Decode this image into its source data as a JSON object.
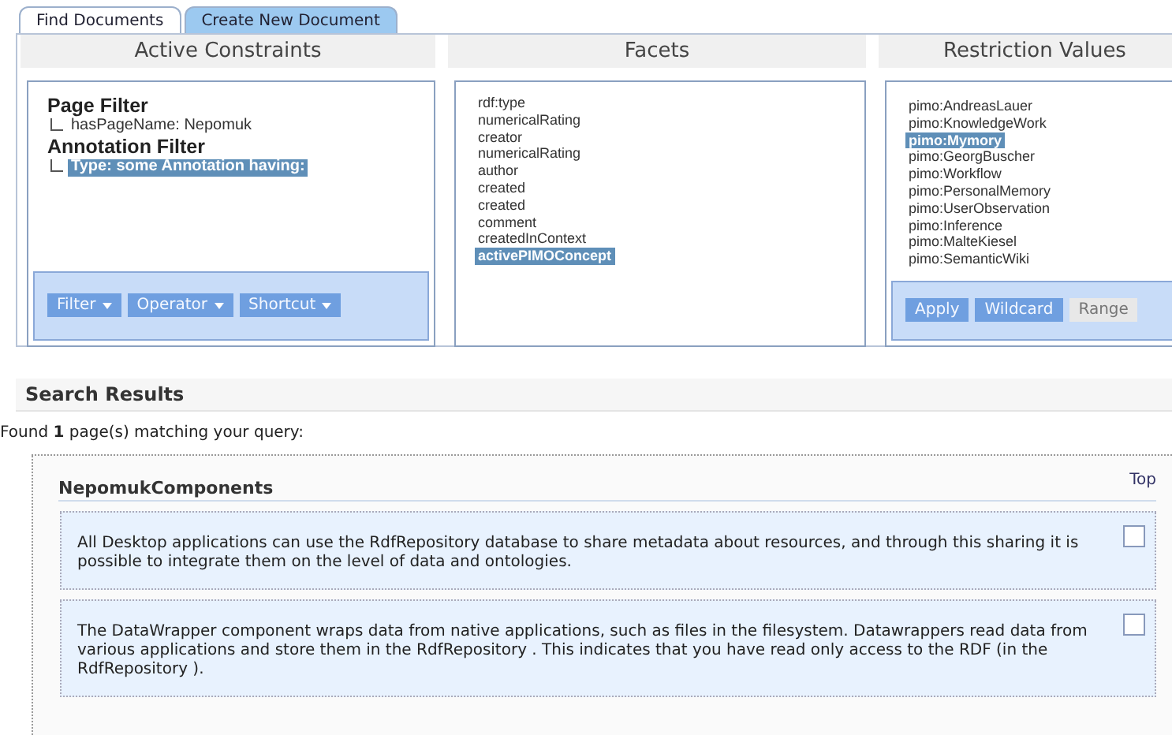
{
  "tabs": [
    {
      "label": "Find Documents",
      "selected": true
    },
    {
      "label": "Create New Document",
      "selected": false
    }
  ],
  "constraints": {
    "title": "Active Constraints",
    "groups": [
      {
        "heading": "Page Filter",
        "items": [
          {
            "label": "hasPageName: Nepomuk",
            "selected": false
          }
        ]
      },
      {
        "heading": "Annotation Filter",
        "items": [
          {
            "label": "Type: some Annotation having:",
            "selected": true
          }
        ]
      }
    ],
    "buttons": [
      {
        "label": "Filter",
        "disabled": false
      },
      {
        "label": "Operator",
        "disabled": false
      },
      {
        "label": "Shortcut",
        "disabled": false
      }
    ]
  },
  "facets": {
    "title": "Facets",
    "items": [
      {
        "label": "rdf:type",
        "selected": false
      },
      {
        "label": "numericalRating",
        "selected": false
      },
      {
        "label": "creator",
        "selected": false
      },
      {
        "label": "numericalRating",
        "selected": false
      },
      {
        "label": "author",
        "selected": false
      },
      {
        "label": "created",
        "selected": false
      },
      {
        "label": "created",
        "selected": false
      },
      {
        "label": "comment",
        "selected": false
      },
      {
        "label": "createdInContext",
        "selected": false
      },
      {
        "label": "activePIMOConcept",
        "selected": true
      }
    ]
  },
  "restriction_values": {
    "title": "Restriction Values",
    "items": [
      {
        "label": "pimo:AndreasLauer",
        "selected": false
      },
      {
        "label": "pimo:KnowledgeWork",
        "selected": false
      },
      {
        "label": "pimo:Mymory",
        "selected": true
      },
      {
        "label": "pimo:GeorgBuscher",
        "selected": false
      },
      {
        "label": "pimo:Workflow",
        "selected": false
      },
      {
        "label": "pimo:PersonalMemory",
        "selected": false
      },
      {
        "label": "pimo:UserObservation",
        "selected": false
      },
      {
        "label": "pimo:Inference",
        "selected": false
      },
      {
        "label": "pimo:MalteKiesel",
        "selected": false
      },
      {
        "label": "pimo:SemanticWiki",
        "selected": false
      }
    ],
    "buttons": [
      {
        "label": "Apply",
        "disabled": false
      },
      {
        "label": "Wildcard",
        "disabled": false
      },
      {
        "label": "Range",
        "disabled": true
      }
    ]
  },
  "search_results": {
    "title": "Search Results",
    "summary": "Found **1** page(s) matching your query:",
    "pages": [
      {
        "title": "NepomukComponents",
        "top_link": "Top",
        "snippets": [
          {
            "text": "All Desktop applications can use the RdfRepository database to share metadata about resources, and through this sharing it is possible to integrate them on the level of data and ontologies.",
            "checked": false
          },
          {
            "text": "The DataWrapper component wraps data from native applications, such as files in the filesystem. Datawrappers read data from various applications and store them in the RdfRepository . This indicates that you have read only access to the RDF (in the RdfRepository ).",
            "checked": false
          }
        ]
      }
    ]
  }
}
